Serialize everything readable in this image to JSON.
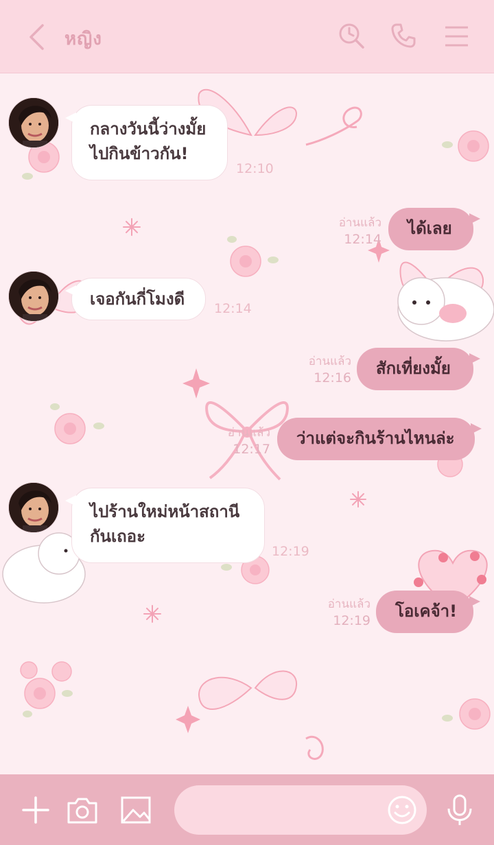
{
  "header": {
    "title": "หญิง"
  },
  "messages": [
    {
      "side": "in",
      "text_lines": [
        "กลางวันนี้ว่างมั้ย",
        "ไปกินข้าวกัน!"
      ],
      "time": "12:10"
    },
    {
      "side": "out",
      "text": "ได้เลย",
      "read": "อ่านแล้ว",
      "time": "12:14"
    },
    {
      "side": "in",
      "text_lines": [
        "เจอกันกี่โมงดี"
      ],
      "time": "12:14"
    },
    {
      "side": "out",
      "text": "สักเที่ยงมั้ย",
      "read": "อ่านแล้ว",
      "time": "12:16"
    },
    {
      "side": "out",
      "text": "ว่าแต่จะกินร้านไหนล่ะ",
      "read": "อ่านแล้ว",
      "time": "12:17"
    },
    {
      "side": "in",
      "text_lines": [
        "ไปร้านใหม่หน้าสถานี",
        "กันเถอะ"
      ],
      "time": "12:19"
    },
    {
      "side": "out",
      "text": "โอเคจ้า!",
      "read": "อ่านแล้ว",
      "time": "12:19"
    }
  ],
  "footer": {
    "input_placeholder": ""
  },
  "colors": {
    "header_bg": "#fbd9e1",
    "chat_bg": "#fdeef2",
    "out_bubble": "#e8a9ba",
    "footer_bg": "#eab2bf",
    "icon_tint": "#e1a2b2"
  },
  "icons": [
    "back-icon",
    "search-icon",
    "phone-icon",
    "menu-icon",
    "plus-icon",
    "camera-icon",
    "image-icon",
    "emoji-icon",
    "mic-icon"
  ]
}
